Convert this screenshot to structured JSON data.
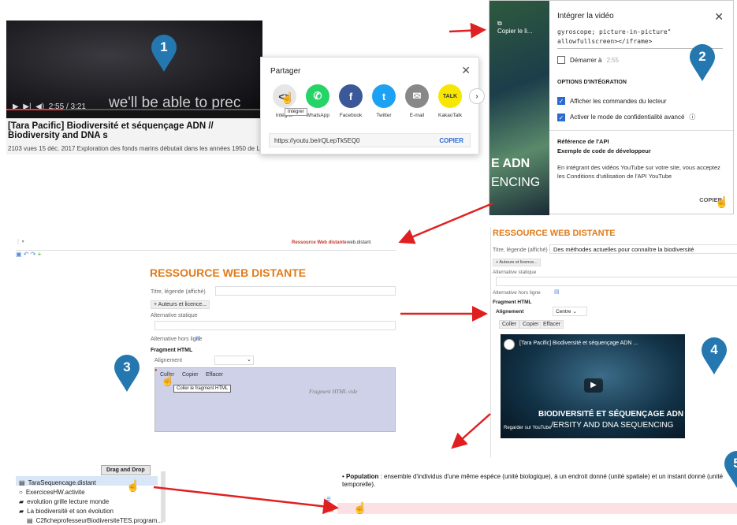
{
  "colors": {
    "marker": "#2577b0",
    "arrow": "#e02020",
    "accent_orange": "#e07b1a",
    "youtube_blue": "#2a6ad1"
  },
  "markers": {
    "m1": "1",
    "m2": "2",
    "m3": "3",
    "m4": "4",
    "m5": "5"
  },
  "panel1": {
    "caption": "we'll be able to prec",
    "time": "2:55 / 3:21",
    "video_title": "[Tara Pacific] Biodiversité et séquençage ADN // Biodiversity and DNA s",
    "meta": "2103 vues  15 déc. 2017  Exploration des fonds marins débutait dans les années 1950 de L..."
  },
  "share": {
    "title": "Partager",
    "items": [
      {
        "label": "Intégrer",
        "glyph": "<>",
        "color": "#e6e6e6"
      },
      {
        "label": "WhatsApp",
        "glyph": "✆",
        "color": "#25d366"
      },
      {
        "label": "Facebook",
        "glyph": "f",
        "color": "#3b5998"
      },
      {
        "label": "Twitter",
        "glyph": "t",
        "color": "#1da1f2"
      },
      {
        "label": "E-mail",
        "glyph": "✉",
        "color": "#888888"
      },
      {
        "label": "KakaoTalk",
        "glyph": "TALK",
        "color": "#f7e600"
      }
    ],
    "tooltip": "Intégrer",
    "url": "https://youtu.be/rQLepTk5EQ0",
    "copy": "COPIER"
  },
  "panel2": {
    "copy_label": "Copier le li...",
    "side_big": "E ADN",
    "side_big2": "ENCING",
    "title": "Intégrer la vidéo",
    "code_l1": "gyroscope; picture-in-picture\"",
    "code_l2": "allowfullscreen></iframe>",
    "start_label": "Démarrer à",
    "start_value": "2:55",
    "options_heading": "OPTIONS D'INTÉGRATION",
    "opt1": "Afficher les commandes du lecteur",
    "opt2": "Activer le mode de confidentialité avancé",
    "api_heading": "Référence de l'API",
    "api_sub": "Exemple de code de développeur",
    "api_text": "En intégrant des vidéos YouTube sur votre site, vous acceptez les Conditions d'utilisation de l'API YouTube",
    "copy": "COPIER"
  },
  "panel3": {
    "res_link": "Ressource Web distante",
    "res_file": "web.distant",
    "heading": "RESSOURCE WEB DISTANTE",
    "title_label": "Titre, légende (affiché)",
    "authors_btn": "+ Auteurs et licence...",
    "alt_label": "Alternative statique",
    "offline_label": "Alternative hors ligne",
    "fragment_label": "Fragment HTML",
    "align_label": "Alignement",
    "paste": "Coller",
    "copy": "Copier",
    "clear": "Effacer",
    "tooltip": "Coller le fragment HTML",
    "empty": "Fragment HTML vide"
  },
  "panel4": {
    "heading": "RESSOURCE WEB DISTANTE",
    "title_label": "Titre, légende (affiché)",
    "title_value": "Des méthodes actuelles pour connaître la biodiversité",
    "authors_btn": "+ Auteurs et licence...",
    "alt_label": "Alternative statique",
    "offline_label": "Alternative hors ligne",
    "fragment_label": "Fragment HTML",
    "align_label": "Alignement",
    "align_value": "Centre",
    "paste": "Coller",
    "copy": "Copier",
    "clear": "Effacer",
    "video_title": "[Tara Pacific] Biodiversité et séquençage ADN ...",
    "video_big1": "BIODIVERSITÉ ET SÉQUENÇAGE ADN",
    "video_big2": "/ERSITY AND DNA SEQUENCING",
    "watch_on": "Regarder sur  YouTube"
  },
  "panel5": {
    "drag_drop": "Drag and Drop",
    "items": [
      {
        "label": "TaraSequencage.distant",
        "icon": "▤"
      },
      {
        "label": "ExercicesHW.activite",
        "icon": "○"
      },
      {
        "label": "evolution grille lecture monde",
        "icon": "▰"
      },
      {
        "label": "La biodiversité et son évolution",
        "icon": "▰"
      },
      {
        "label": "C2ficheprofesseurBiodiversiteTES.program...",
        "icon": "▤"
      }
    ]
  },
  "panel6": {
    "bullet_term": "Population",
    "bullet_text": " : ensemble d'individus d'une même espèce (unité biologique), à un endroit donné (unité spatiale) et un instant donné (unité temporelle)."
  }
}
